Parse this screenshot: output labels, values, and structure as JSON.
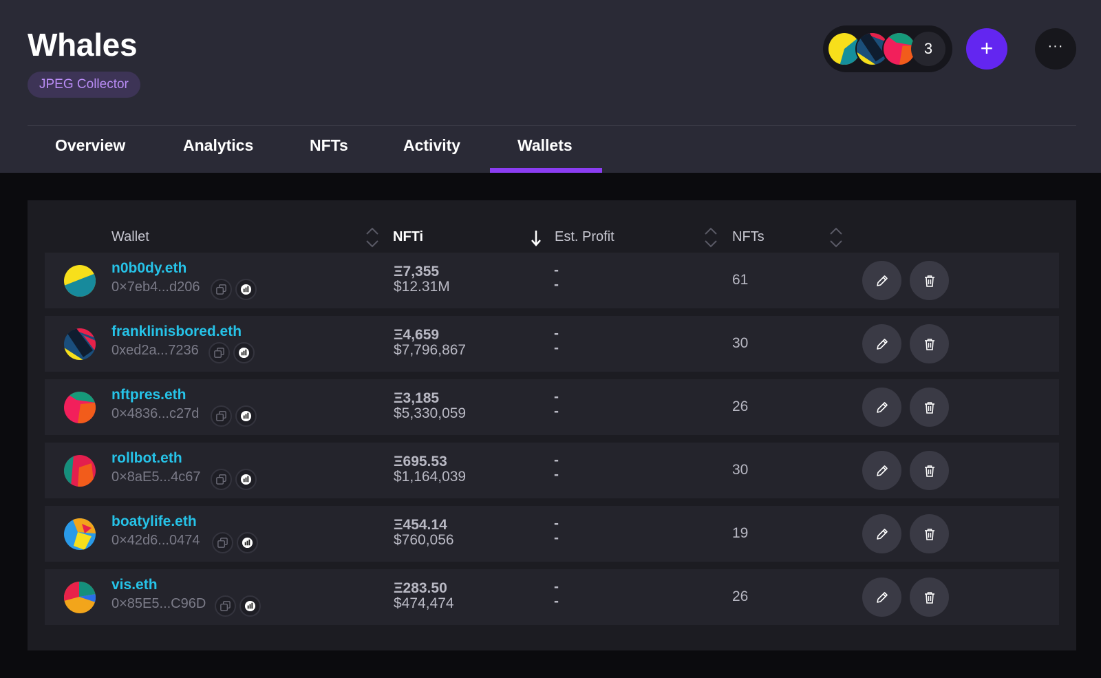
{
  "header": {
    "title": "Whales",
    "badge": "JPEG Collector",
    "members_count": "3",
    "add_icon": "plus-icon",
    "more_icon": "ellipsis-icon"
  },
  "tabs": [
    "Overview",
    "Analytics",
    "NFTs",
    "Activity",
    "Wallets"
  ],
  "active_tab": "Wallets",
  "colors": {
    "accent": "#6326f0",
    "tab_underline": "#8b3df2",
    "wallet_name": "#26c3e8",
    "badge_text": "#b98cf5"
  },
  "table": {
    "columns": [
      "Wallet",
      "NFTi",
      "Est. Profit",
      "NFTs"
    ],
    "sorted_by": "NFTi",
    "rows": [
      {
        "name": "n0b0dy.eth",
        "address": "0×7eb4...d206",
        "eth": "Ξ7,355",
        "usd": "$12.31M",
        "profit_top": "-",
        "profit_bottom": "-",
        "nfts": "61"
      },
      {
        "name": "franklinisbored.eth",
        "address": "0xed2a...7236",
        "eth": "Ξ4,659",
        "usd": "$7,796,867",
        "profit_top": "-",
        "profit_bottom": "-",
        "nfts": "30"
      },
      {
        "name": "nftpres.eth",
        "address": "0×4836...c27d",
        "eth": "Ξ3,185",
        "usd": "$5,330,059",
        "profit_top": "-",
        "profit_bottom": "-",
        "nfts": "26"
      },
      {
        "name": "rollbot.eth",
        "address": "0×8aE5...4c67",
        "eth": "Ξ695.53",
        "usd": "$1,164,039",
        "profit_top": "-",
        "profit_bottom": "-",
        "nfts": "30"
      },
      {
        "name": "boatylife.eth",
        "address": "0×42d6...0474",
        "eth": "Ξ454.14",
        "usd": "$760,056",
        "profit_top": "-",
        "profit_bottom": "-",
        "nfts": "19"
      },
      {
        "name": "vis.eth",
        "address": "0×85E5...C96D",
        "eth": "Ξ283.50",
        "usd": "$474,474",
        "profit_top": "-",
        "profit_bottom": "-",
        "nfts": "26"
      }
    ]
  }
}
